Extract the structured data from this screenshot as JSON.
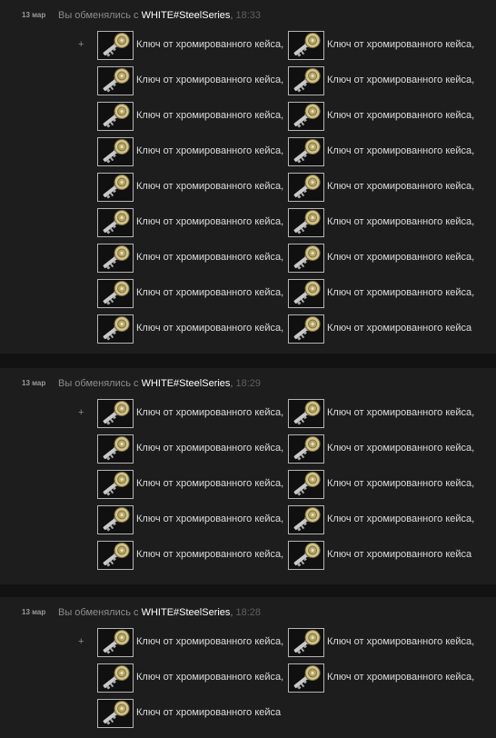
{
  "trades": [
    {
      "date": "13 мар",
      "prefix": "Вы обменялись с",
      "user": "WHITE#SteelSeries",
      "time": "18:33",
      "plus": "+",
      "items": [
        "Ключ от хромированного кейса,",
        "Ключ от хромированного кейса,",
        "Ключ от хромированного кейса,",
        "Ключ от хромированного кейса,",
        "Ключ от хромированного кейса,",
        "Ключ от хромированного кейса,",
        "Ключ от хромированного кейса,",
        "Ключ от хромированного кейса,",
        "Ключ от хромированного кейса,",
        "Ключ от хромированного кейса,",
        "Ключ от хромированного кейса,",
        "Ключ от хромированного кейса,",
        "Ключ от хромированного кейса,",
        "Ключ от хромированного кейса,",
        "Ключ от хромированного кейса,",
        "Ключ от хромированного кейса,",
        "Ключ от хромированного кейса,",
        "Ключ от хромированного кейса"
      ]
    },
    {
      "date": "13 мар",
      "prefix": "Вы обменялись с",
      "user": "WHITE#SteelSeries",
      "time": "18:29",
      "plus": "+",
      "items": [
        "Ключ от хромированного кейса,",
        "Ключ от хромированного кейса,",
        "Ключ от хромированного кейса,",
        "Ключ от хромированного кейса,",
        "Ключ от хромированного кейса,",
        "Ключ от хромированного кейса,",
        "Ключ от хромированного кейса,",
        "Ключ от хромированного кейса,",
        "Ключ от хромированного кейса,",
        "Ключ от хромированного кейса"
      ]
    },
    {
      "date": "13 мар",
      "prefix": "Вы обменялись с",
      "user": "WHITE#SteelSeries",
      "time": "18:28",
      "plus": "+",
      "items": [
        "Ключ от хромированного кейса,",
        "Ключ от хромированного кейса,",
        "Ключ от хромированного кейса,",
        "Ключ от хромированного кейса,",
        "Ключ от хромированного кейса"
      ]
    }
  ],
  "colors": {
    "background": "#1b1b1c",
    "username": "#ffffff",
    "description": "#8c8c8c",
    "time": "#5f5f5f",
    "item_text": "#dcdcdc",
    "thumb_border": "#b5b5b5"
  },
  "icons": {
    "item_thumbnail": "key-icon"
  }
}
